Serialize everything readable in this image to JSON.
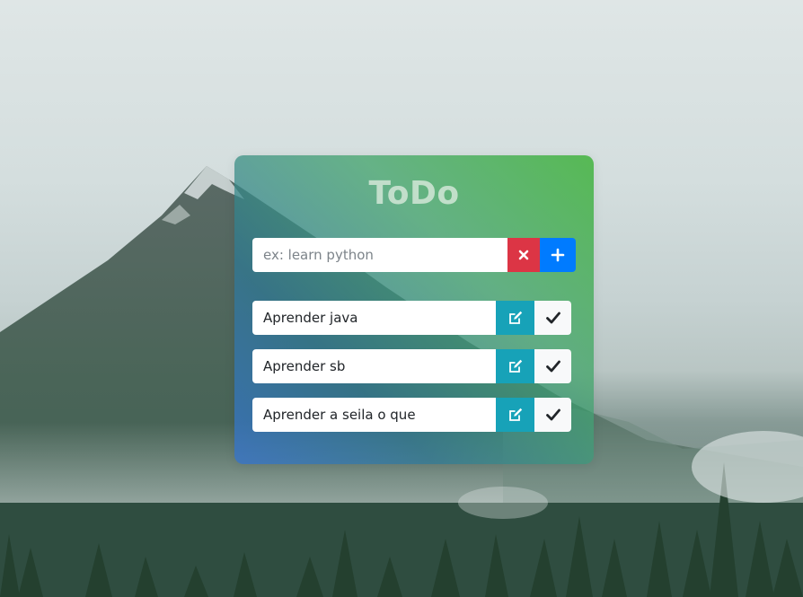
{
  "app": {
    "title": "ToDo"
  },
  "new_task": {
    "placeholder": "ex: learn python",
    "value": ""
  },
  "tasks": [
    {
      "label": "Aprender java"
    },
    {
      "label": "Aprender sb"
    },
    {
      "label": "Aprender a seila o que"
    }
  ],
  "icons": {
    "clear": "close-icon",
    "add": "plus-icon",
    "edit": "edit-icon",
    "done": "check-icon"
  },
  "colors": {
    "clear_button": "#dc3545",
    "add_button": "#007bff",
    "edit_button": "#17a2b8",
    "done_button": "#f8f9fa",
    "card_gradient_start": "#4cb648",
    "card_gradient_end": "#3773c8"
  }
}
